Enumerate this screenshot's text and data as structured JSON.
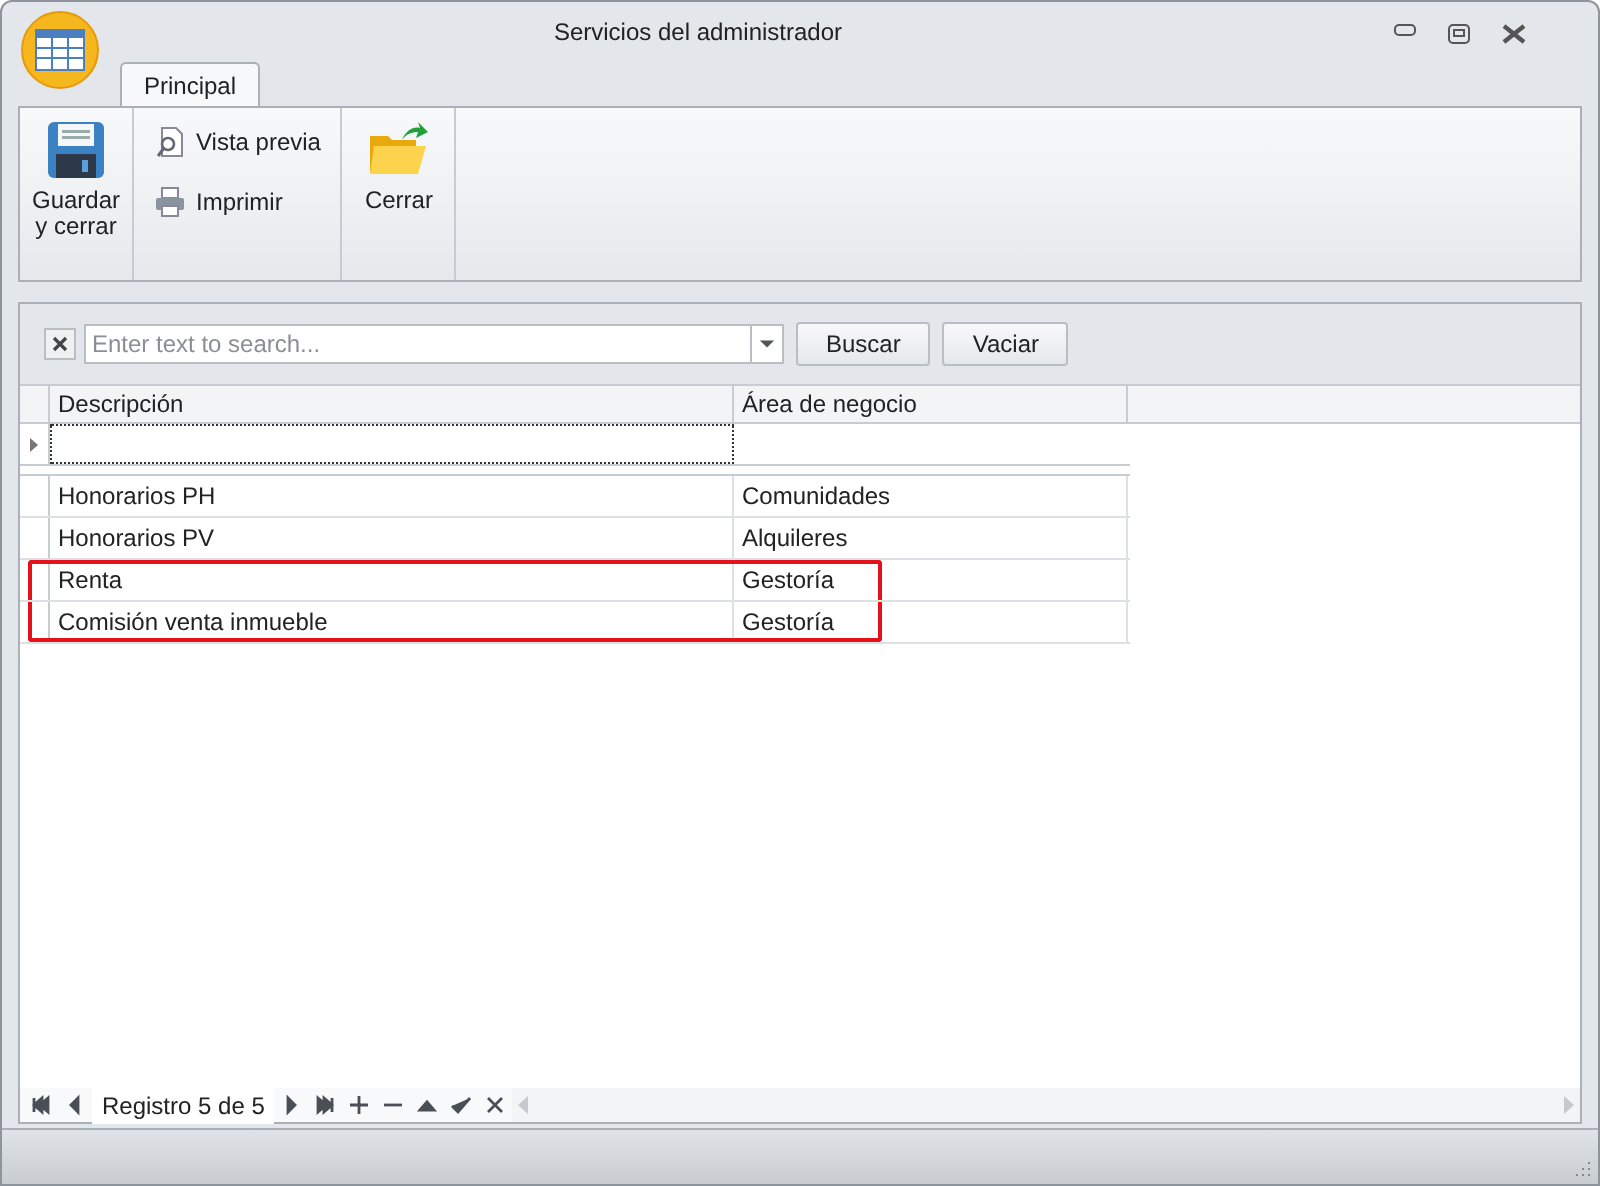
{
  "window": {
    "title": "Servicios del administrador"
  },
  "tabs": [
    {
      "label": "Principal",
      "selected": true
    }
  ],
  "ribbon": {
    "groups": [
      {
        "items": [
          {
            "kind": "large",
            "label": "Guardar y cerrar"
          }
        ]
      },
      {
        "items": [
          {
            "kind": "small",
            "label": "Vista previa"
          },
          {
            "kind": "small",
            "label": "Imprimir"
          }
        ]
      },
      {
        "items": [
          {
            "kind": "large",
            "label": "Cerrar"
          }
        ]
      }
    ]
  },
  "search": {
    "placeholder": "Enter text to search...",
    "buttons": [
      "Buscar",
      "Vaciar"
    ]
  },
  "table": {
    "columns": [
      "Descripción",
      "Área de negocio"
    ],
    "rows": [
      {
        "cells": [
          "Honorarios PH",
          "Comunidades"
        ],
        "highlighted": false
      },
      {
        "cells": [
          "Honorarios PV",
          "Alquileres"
        ],
        "highlighted": false
      },
      {
        "cells": [
          "Renta",
          "Gestoría"
        ],
        "highlighted": true
      },
      {
        "cells": [
          "Comisión venta inmueble",
          "Gestoría"
        ],
        "highlighted": true
      }
    ]
  },
  "navigator": {
    "text": "Registro 5 de 5"
  }
}
